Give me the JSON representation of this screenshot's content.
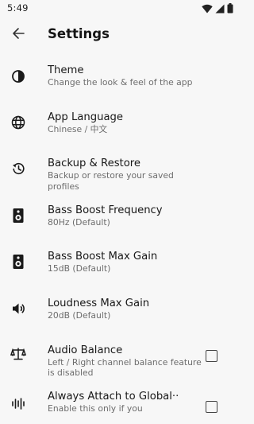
{
  "status_bar": {
    "time": "5:49",
    "icons": [
      "wifi-icon",
      "signal-icon",
      "battery-icon"
    ]
  },
  "app_bar": {
    "back_icon": "arrow-left-icon",
    "title": "Settings"
  },
  "settings": [
    {
      "icon": "contrast-icon",
      "title": "Theme",
      "subtitle": "Change the look & feel of the app"
    },
    {
      "icon": "globe-icon",
      "title": "App Language",
      "subtitle": "Chinese / 中文"
    },
    {
      "icon": "restore-icon",
      "title": "Backup & Restore",
      "subtitle": "Backup or restore your saved profiles"
    },
    {
      "icon": "speaker-icon",
      "title": "Bass Boost Frequency",
      "subtitle": "80Hz (Default)"
    },
    {
      "icon": "speaker-icon",
      "title": "Bass Boost Max Gain",
      "subtitle": "15dB (Default)"
    },
    {
      "icon": "volume-icon",
      "title": "Loudness Max Gain",
      "subtitle": "20dB (Default)"
    },
    {
      "icon": "balance-scale-icon",
      "title": "Audio Balance",
      "subtitle": "Left / Right channel balance feature is disabled",
      "checked": false
    },
    {
      "icon": "equalizer-icon",
      "title": "Always Attach to Global··",
      "subtitle": "Enable this only if you",
      "checked": false
    }
  ]
}
